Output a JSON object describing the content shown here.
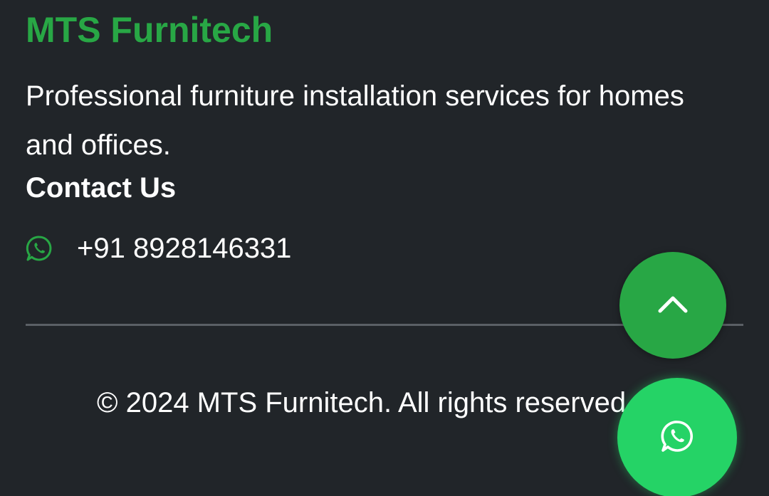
{
  "brand": {
    "name": "MTS Furnitech",
    "description": "Professional furniture installation services for homes and offices."
  },
  "contact": {
    "heading": "Contact Us",
    "phone": "+91 8928146331",
    "icon": "whatsapp-icon"
  },
  "footer": {
    "copyright": "© 2024 MTS Furnitech. All rights reserved."
  },
  "floating_buttons": {
    "scroll_top_icon": "chevron-up-icon",
    "whatsapp_icon": "whatsapp-icon"
  },
  "colors": {
    "background": "#212529",
    "brand_green": "#28a745",
    "whatsapp_green": "#25d366",
    "text": "#ffffff",
    "divider": "#5a5f65"
  }
}
